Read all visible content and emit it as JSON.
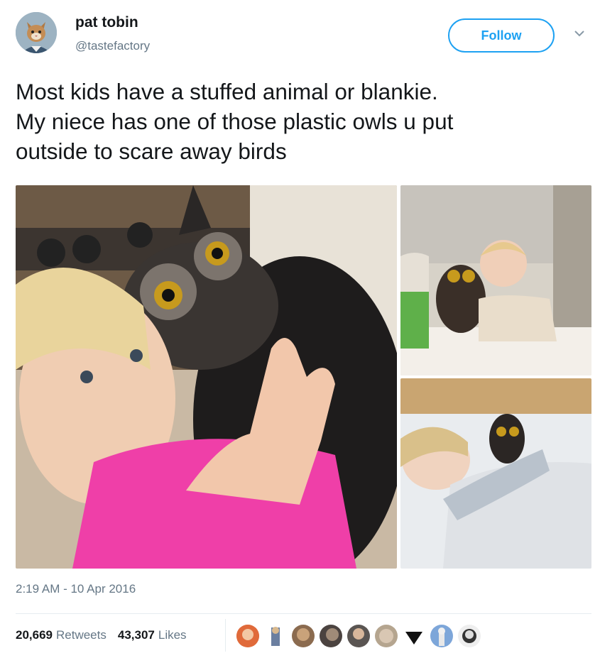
{
  "author": {
    "name": "pat tobin",
    "handle": "@tastefactory",
    "avatar_icon": "cat-avatar-icon"
  },
  "follow_label": "Follow",
  "tweet": {
    "line1": "Most kids have a stuffed animal or blankie.",
    "line2": "My niece has one of those plastic owls u put",
    "line3": "outside to scare away birds"
  },
  "timestamp": "2:19 AM - 10 Apr 2016",
  "stats": {
    "retweets_count": "20,669",
    "retweets_label": "Retweets",
    "likes_count": "43,307",
    "likes_label": "Likes"
  },
  "colors": {
    "accent": "#1da1f2",
    "secondary_text": "#657786",
    "divider": "#e6ecf0"
  },
  "likers": [
    "liker-1",
    "liker-2",
    "liker-3",
    "liker-4",
    "liker-5",
    "liker-6",
    "liker-7",
    "liker-8",
    "liker-9"
  ]
}
